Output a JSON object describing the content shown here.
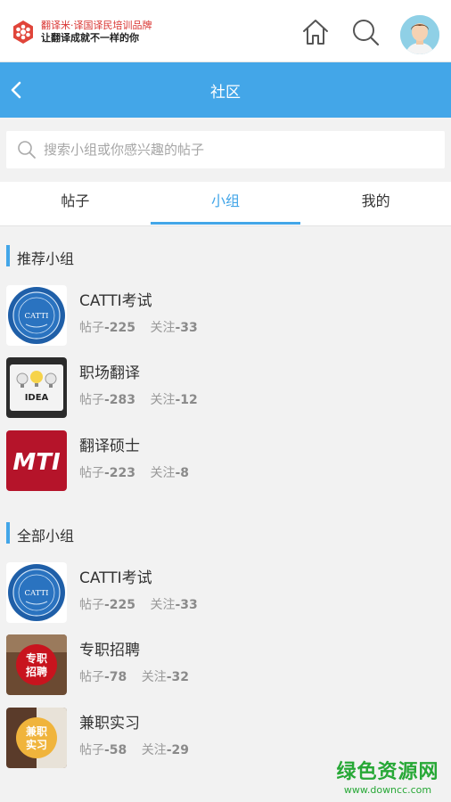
{
  "brand": {
    "line1": "翻译米·译国译民培训品牌",
    "line2": "让翻译成就不一样的你"
  },
  "icons": {
    "home": "home-icon",
    "search": "search-icon",
    "avatar": "user-avatar",
    "back": "chevron-left-icon"
  },
  "colors": {
    "accent": "#43a6e8",
    "brand_red": "#d9322f"
  },
  "header": {
    "title": "社区"
  },
  "search": {
    "placeholder": "搜索小组或你感兴趣的帖子"
  },
  "tabs": [
    {
      "label": "帖子",
      "active": false
    },
    {
      "label": "小组",
      "active": true
    },
    {
      "label": "我的",
      "active": false
    }
  ],
  "recommended": {
    "title": "推荐小组",
    "items": [
      {
        "name": "CATTI考试",
        "posts_label": "帖子",
        "posts": "-225",
        "follow_label": "关注",
        "follows": "-33",
        "thumb": "catti-badge"
      },
      {
        "name": "职场翻译",
        "posts_label": "帖子",
        "posts": "-283",
        "follow_label": "关注",
        "follows": "-12",
        "thumb": "idea-bulbs",
        "thumb_text": "IDEA"
      },
      {
        "name": "翻译硕士",
        "posts_label": "帖子",
        "posts": "-223",
        "follow_label": "关注",
        "follows": "-8",
        "thumb": "mti-logo",
        "thumb_text": "MTI"
      }
    ]
  },
  "all_groups": {
    "title": "全部小组",
    "items": [
      {
        "name": "CATTI考试",
        "posts_label": "帖子",
        "posts": "-225",
        "follow_label": "关注",
        "follows": "-33",
        "thumb": "catti-badge"
      },
      {
        "name": "专职招聘",
        "posts_label": "帖子",
        "posts": "-78",
        "follow_label": "关注",
        "follows": "-32",
        "thumb": "fulltime-badge",
        "thumb_text": "专职招聘"
      },
      {
        "name": "兼职实习",
        "posts_label": "帖子",
        "posts": "-58",
        "follow_label": "关注",
        "follows": "-29",
        "thumb": "parttime-badge",
        "thumb_text": "兼职实习"
      }
    ]
  },
  "watermark": {
    "big": "绿色资源网",
    "small": "www.downcc.com"
  }
}
